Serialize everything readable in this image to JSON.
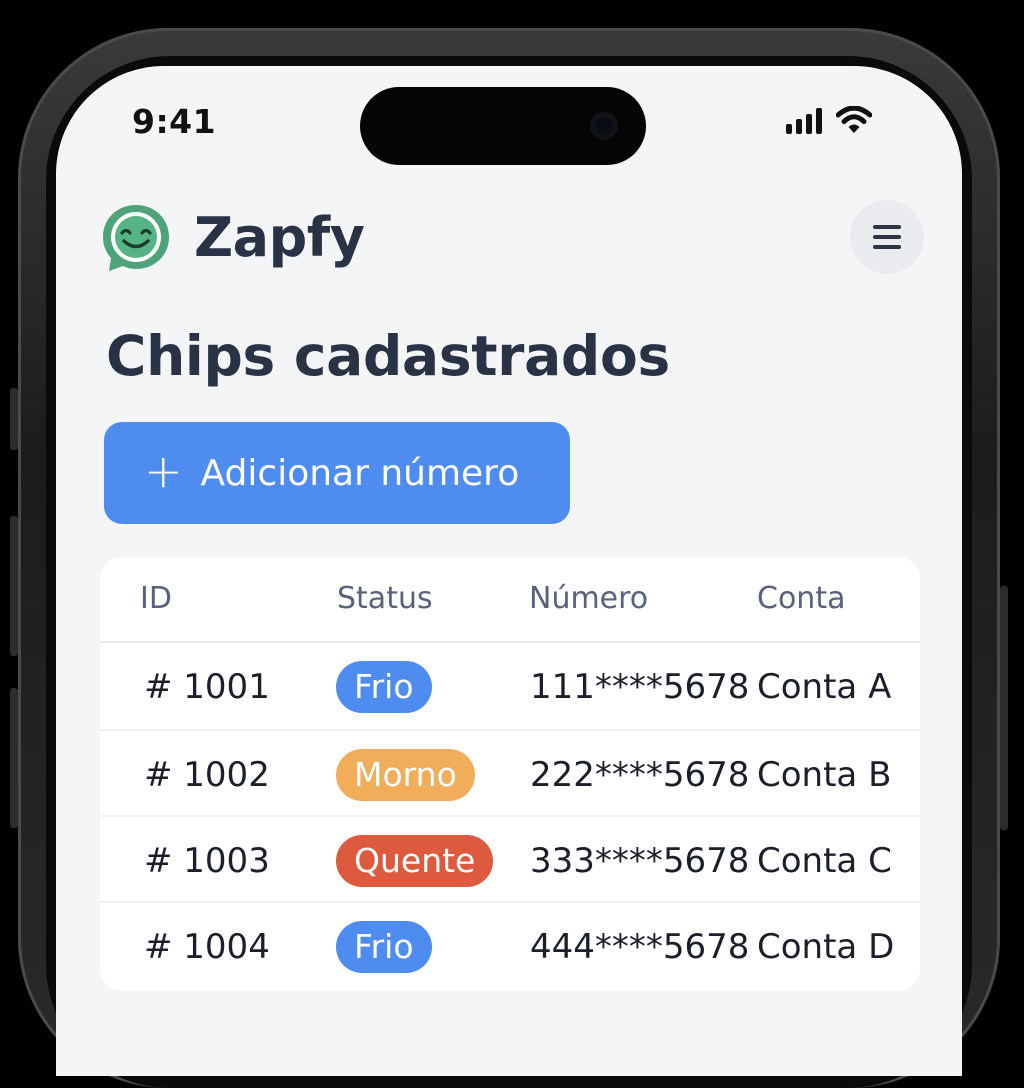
{
  "status_bar": {
    "time": "9:41"
  },
  "app": {
    "name": "Zapfy"
  },
  "page": {
    "title": "Chips cadastrados",
    "add_button": {
      "icon": "+",
      "label": "Adicionar número"
    }
  },
  "table": {
    "columns": [
      "ID",
      "Status",
      "Número",
      "Conta"
    ],
    "rows": [
      {
        "id": "# 1001",
        "status": "Frio",
        "status_color": "#4e8cf0",
        "number": "111****5678",
        "account": "Conta A"
      },
      {
        "id": "# 1002",
        "status": "Morno",
        "status_color": "#f1ad5a",
        "number": "222****5678",
        "account": "Conta B"
      },
      {
        "id": "# 1003",
        "status": "Quente",
        "status_color": "#dd5a3f",
        "number": "333****5678",
        "account": "Conta C"
      },
      {
        "id": "# 1004",
        "status": "Frio",
        "status_color": "#4e8cf0",
        "number": "444****5678",
        "account": "Conta D"
      }
    ]
  },
  "colors": {
    "accent": "#4e8cf0",
    "logo_green": "#4fa37b",
    "title_text": "#2a3245",
    "background": "#f4f5f7"
  },
  "icons": {
    "logo": "smiling-chat-bubble-icon",
    "menu": "hamburger-menu-icon",
    "signal": "cellular-signal-icon",
    "wifi": "wifi-icon"
  }
}
